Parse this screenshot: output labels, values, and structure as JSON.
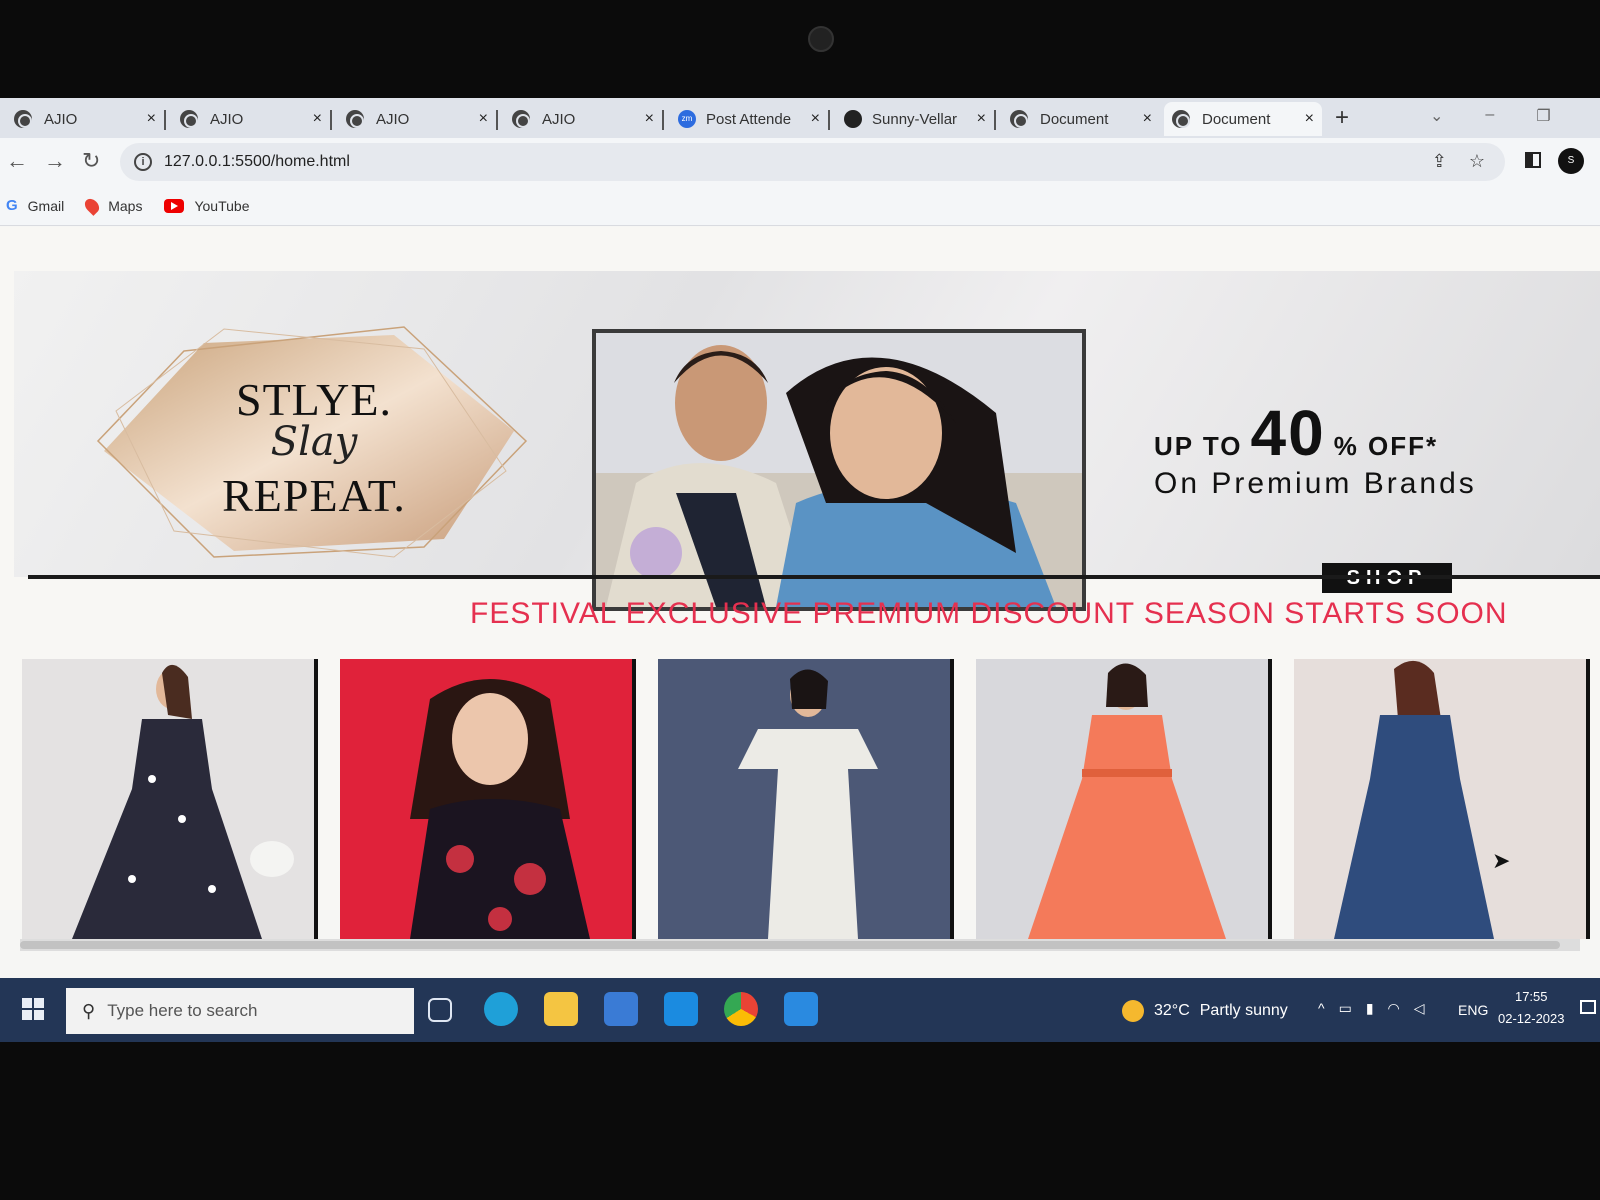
{
  "browser": {
    "tabs": [
      {
        "title": "AJIO",
        "favicon": "globe-icon",
        "active": false
      },
      {
        "title": "AJIO",
        "favicon": "globe-icon",
        "active": false
      },
      {
        "title": "AJIO",
        "favicon": "globe-icon",
        "active": false
      },
      {
        "title": "AJIO",
        "favicon": "globe-icon",
        "active": false
      },
      {
        "title": "Post Attende",
        "favicon": "zoom-icon",
        "active": false
      },
      {
        "title": "Sunny-Vellar",
        "favicon": "github-icon",
        "active": false
      },
      {
        "title": "Document",
        "favicon": "globe-icon",
        "active": false
      },
      {
        "title": "Document",
        "favicon": "globe-icon",
        "active": true
      }
    ],
    "tab_close": "×",
    "new_tab": "+",
    "url": "127.0.0.1:5500/home.html",
    "profile_initial": "S",
    "bookmarks": [
      {
        "label": "Gmail",
        "icon": "google-icon"
      },
      {
        "label": "Maps",
        "icon": "maps-icon"
      },
      {
        "label": "YouTube",
        "icon": "youtube-icon"
      }
    ]
  },
  "hero": {
    "slogan_line1": "STLYE.",
    "slogan_line2": "Slay",
    "slogan_line3": "REPEAT.",
    "offer_prefix": "UP TO",
    "offer_percent": "40",
    "offer_suffix": "% OFF*",
    "offer_subtitle": "On Premium Brands",
    "shop_label": "SHOP"
  },
  "festival_banner": "FESTIVAL EXCLUSIVE PREMIUM DISCOUNT SEASON STARTS SOON",
  "products": [
    {
      "name": "floral-maxi-dress",
      "bg": "#e4e2e2",
      "dress": "#2a2a3a"
    },
    {
      "name": "floral-ruffle-top",
      "bg": "#e0223a",
      "dress": "#1b1420"
    },
    {
      "name": "white-flutter-dress",
      "bg": "#4c5876",
      "dress": "#ecebe6"
    },
    {
      "name": "orange-tiered-dress",
      "bg": "#d8d8dc",
      "dress": "#f47a5a"
    },
    {
      "name": "blue-wrap-dress",
      "bg": "#e6dedb",
      "dress": "#2f4c7d"
    }
  ],
  "taskbar": {
    "search_placeholder": "Type here to search",
    "weather_temp": "32°C",
    "weather_desc": "Partly sunny",
    "language": "ENG",
    "time": "17:55",
    "date": "02-12-2023"
  },
  "colors": {
    "festival_text": "#e5304f",
    "taskbar": "#233656",
    "shop_button": "#111111"
  }
}
